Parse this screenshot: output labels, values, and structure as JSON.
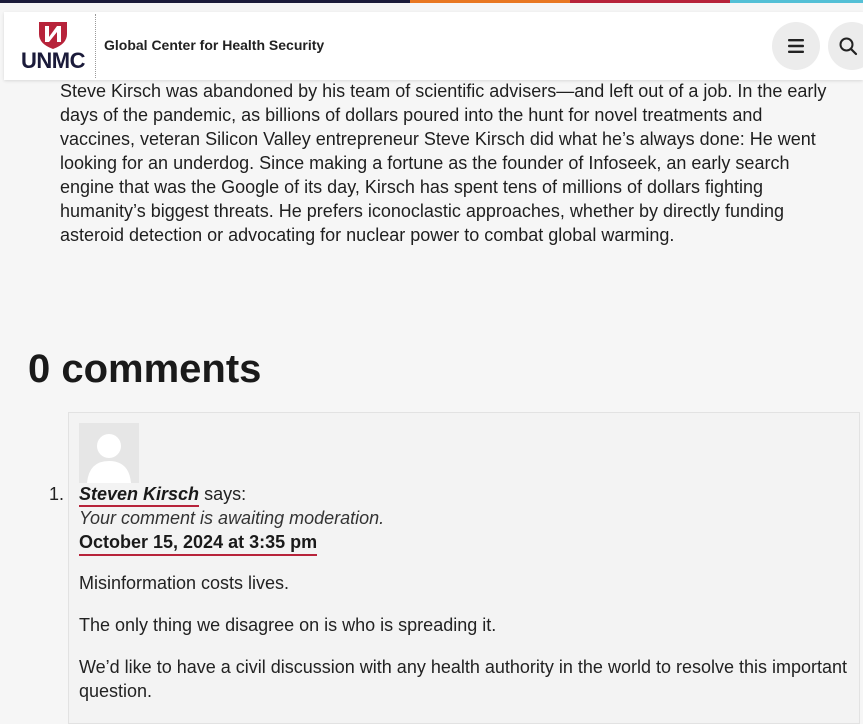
{
  "colors": {
    "stripe": [
      "#1b1b3a",
      "#e87722",
      "#b7233a",
      "#54c0d6"
    ],
    "brand_red": "#b7233a",
    "brand_navy": "#1b1b3a"
  },
  "header": {
    "logo_text": "UNMC",
    "site_title": "Global Center for Health Security",
    "menu_icon": "hamburger-menu-icon",
    "search_icon": "search-icon"
  },
  "article": {
    "text": "Steve Kirsch was abandoned by his team of scientific advisers—and left out of a job. In the early days of the pandemic, as billions of dollars poured into the hunt for novel treatments and vaccines, veteran Silicon Valley entrepreneur Steve Kirsch did what he’s always done: He went looking for an underdog.  Since making a fortune as the founder of Infoseek, an early search engine that was the Google of its day, Kirsch has spent tens of millions of dollars fighting humanity’s biggest threats. He prefers iconoclastic approaches, whether by directly funding asteroid detection or advocating for nuclear power to combat global warming."
  },
  "comments": {
    "heading": "0 comments",
    "items": [
      {
        "number": "1.",
        "avatar_icon": "default-avatar-icon",
        "author": "Steven Kirsch",
        "says": "says:",
        "moderation": "Your comment is awaiting moderation.",
        "date": "October 15, 2024 at 3:35 pm",
        "paragraphs": [
          "Misinformation costs lives.",
          "The only thing we disagree on is who is spreading it.",
          "We’d like to have a civil discussion with any health authority in the world to resolve this important question."
        ]
      }
    ]
  }
}
